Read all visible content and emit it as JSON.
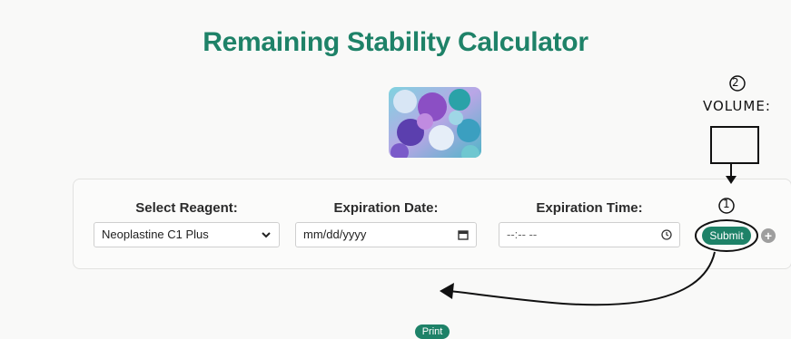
{
  "page": {
    "title": "Remaining Stability Calculator"
  },
  "form": {
    "reagent_label": "Select Reagent:",
    "reagent_value": "Neoplastine C1 Plus",
    "date_label": "Expiration Date:",
    "date_value": "mm/dd/yyyy",
    "time_label": "Expiration Time:",
    "time_value": "--:-- --",
    "submit_label": "Submit",
    "add_symbol": "+"
  },
  "footer": {
    "print_label": "Print"
  },
  "annotations": {
    "marker_two": "2",
    "volume_text": "VOLUME:",
    "marker_one": "1"
  },
  "icons": {
    "reagent_chevron": "chevron-down-icon",
    "date_picker": "calendar-icon",
    "time_picker": "clock-icon",
    "add": "plus-icon"
  },
  "colors": {
    "accent": "#1e8268",
    "background": "#f9f9f8",
    "add_button": "#9e9e9e"
  }
}
